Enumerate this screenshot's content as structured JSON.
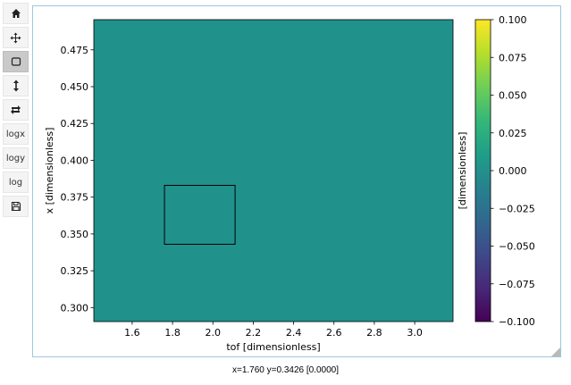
{
  "toolbar": {
    "buttons": [
      {
        "name": "home-button",
        "icon": "home-icon",
        "label": ""
      },
      {
        "name": "pan-button",
        "icon": "move-icon",
        "label": ""
      },
      {
        "name": "zoom-button",
        "icon": "zoom-rect-icon",
        "label": "",
        "active": true
      },
      {
        "name": "autoscale-button",
        "icon": "vertical-arrows-icon",
        "label": ""
      },
      {
        "name": "transpose-button",
        "icon": "swap-icon",
        "label": ""
      },
      {
        "name": "logx-button",
        "icon": "",
        "label": "logx"
      },
      {
        "name": "logy-button",
        "icon": "",
        "label": "logy"
      },
      {
        "name": "log-button",
        "icon": "",
        "label": "log"
      },
      {
        "name": "save-button",
        "icon": "save-icon",
        "label": ""
      }
    ]
  },
  "chart_data": {
    "type": "heatmap",
    "xlabel": "tof [dimensionless]",
    "ylabel": "x [dimensionless]",
    "xlim": [
      1.41,
      3.19
    ],
    "ylim": [
      0.2905,
      0.4955
    ],
    "xticks": [
      1.6,
      1.8,
      2.0,
      2.2,
      2.4,
      2.6,
      2.8,
      3.0
    ],
    "xtick_labels": [
      "1.6",
      "1.8",
      "2.0",
      "2.2",
      "2.4",
      "2.6",
      "2.8",
      "3.0"
    ],
    "yticks": [
      0.3,
      0.325,
      0.35,
      0.375,
      0.4,
      0.425,
      0.45,
      0.475
    ],
    "ytick_labels": [
      "0.300",
      "0.325",
      "0.350",
      "0.375",
      "0.400",
      "0.425",
      "0.450",
      "0.475"
    ],
    "values": [
      [
        0.0
      ]
    ],
    "fill_color": "#21918c",
    "selection_box": {
      "x": [
        1.76,
        2.11
      ],
      "y": [
        0.343,
        0.383
      ]
    },
    "colorbar": {
      "label": "[dimensionless]",
      "range": [
        -0.1,
        0.1
      ],
      "ticks": [
        -0.1,
        -0.075,
        -0.05,
        -0.025,
        0.0,
        0.025,
        0.05,
        0.075,
        0.1
      ],
      "tick_labels": [
        "−0.100",
        "−0.075",
        "−0.050",
        "−0.025",
        "0.000",
        "0.025",
        "0.050",
        "0.075",
        "0.100"
      ],
      "colormap": [
        "#440154",
        "#482878",
        "#3e4989",
        "#31688e",
        "#26828e",
        "#1f9e89",
        "#35b779",
        "#6ece58",
        "#b5de2b",
        "#fde725"
      ]
    }
  },
  "status": {
    "text": "x=1.760 y=0.3426 [0.0000]"
  }
}
